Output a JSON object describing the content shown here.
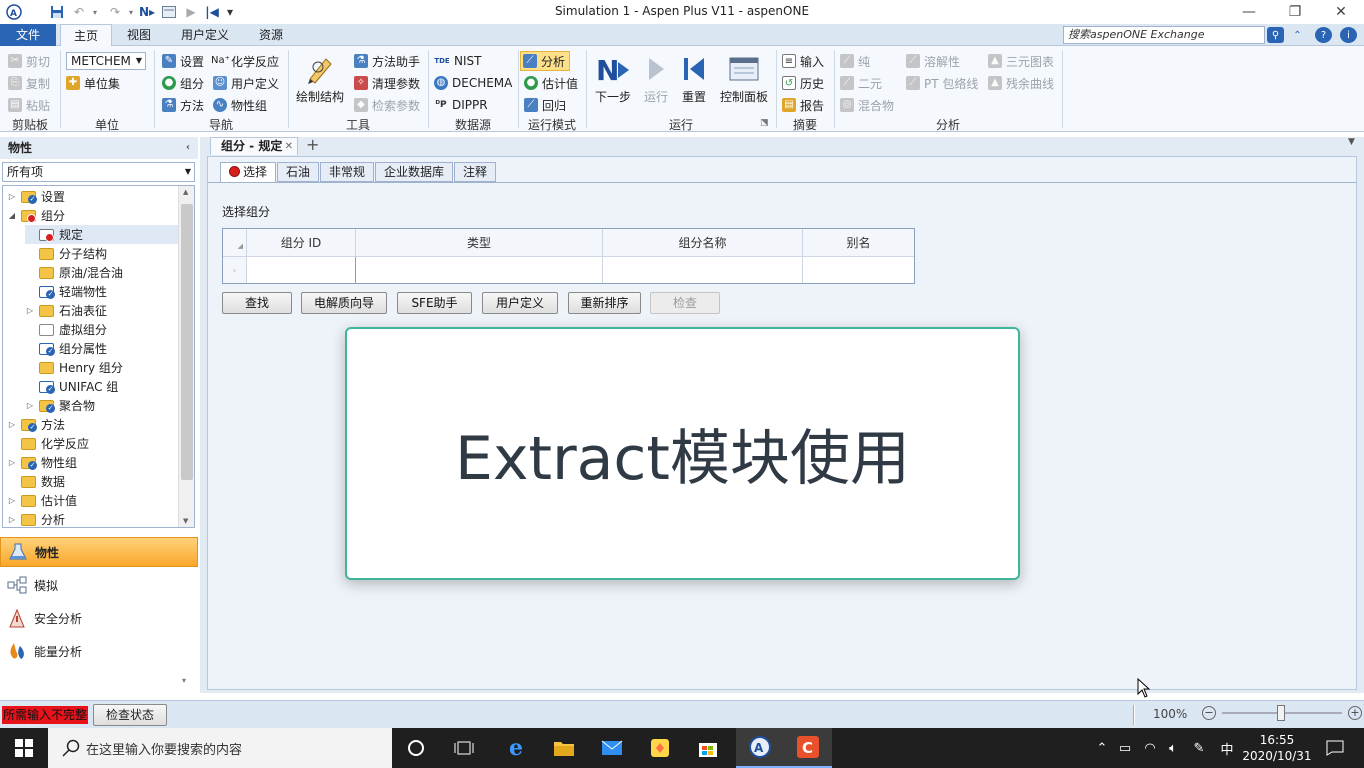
{
  "window": {
    "title": "Simulation 1 - Aspen Plus V11 - aspenONE"
  },
  "quick_access": {
    "save_icon": "save-icon",
    "undo_icon": "undo-icon",
    "redo_icon": "redo-icon",
    "next_icon": "next-icon",
    "run_icon": "run-icon",
    "reset_icon": "reset-icon",
    "menu_icon": "menu-icon"
  },
  "menu": {
    "tabs": [
      "文件",
      "主页",
      "视图",
      "用户定义",
      "资源"
    ],
    "active": "主页",
    "search_placeholder": "搜索aspenONE Exchange"
  },
  "ribbon": {
    "clipboard": {
      "cut": "剪切",
      "copy": "复制",
      "paste": "粘贴",
      "label": "剪贴板"
    },
    "units": {
      "unit_set": "METCHEM",
      "unit_sets": "单位集",
      "label": "单位"
    },
    "navigation": {
      "settings": "设置",
      "components": "组分",
      "methods": "方法",
      "chemistry": "化学反应",
      "user_defined": "用户定义",
      "prop_sets": "物性组",
      "label": "导航"
    },
    "tools": {
      "draw_structure": "绘制结构",
      "method_assistant": "方法助手",
      "clean_params": "清理参数",
      "retrieve_params": "检索参数",
      "label": "工具"
    },
    "data_source": {
      "nist": "NIST",
      "dechema": "DECHEMA",
      "dippr": "DIPPR",
      "label": "数据源"
    },
    "run_mode": {
      "analysis": "分析",
      "estimation": "估计值",
      "regression": "回归",
      "label": "运行模式"
    },
    "run": {
      "next": "下一步",
      "run": "运行",
      "reset": "重置",
      "control_panel": "控制面板",
      "label": "运行"
    },
    "summary": {
      "input": "输入",
      "history": "历史",
      "report": "报告",
      "label": "摘要"
    },
    "analysis": {
      "pure": "纯",
      "binary": "二元",
      "mixture": "混合物",
      "solubility": "溶解性",
      "pt_envelope": "PT 包络线",
      "ternary_maps": "三元图表",
      "residue_curves": "残余曲线",
      "label": "分析"
    }
  },
  "nav": {
    "header": "物性",
    "filter": "所有项",
    "tree": [
      {
        "label": "设置",
        "level": 0,
        "expander": "▷",
        "icon": "folder-check"
      },
      {
        "label": "组分",
        "level": 0,
        "expander": "◢",
        "icon": "folder-red"
      },
      {
        "label": "规定",
        "level": 1,
        "expander": "",
        "icon": "red-form",
        "selected": true
      },
      {
        "label": "分子结构",
        "level": 1,
        "expander": "",
        "icon": "folder"
      },
      {
        "label": "原油/混合油",
        "level": 1,
        "expander": "",
        "icon": "folder"
      },
      {
        "label": "轻端物性",
        "level": 1,
        "expander": "",
        "icon": "check-form"
      },
      {
        "label": "石油表征",
        "level": 1,
        "expander": "▷",
        "icon": "folder"
      },
      {
        "label": "虚拟组分",
        "level": 1,
        "expander": "",
        "icon": "empty-form"
      },
      {
        "label": "组分属性",
        "level": 1,
        "expander": "",
        "icon": "check-form"
      },
      {
        "label": "Henry 组分",
        "level": 1,
        "expander": "",
        "icon": "folder"
      },
      {
        "label": "UNIFAC 组",
        "level": 1,
        "expander": "",
        "icon": "check-form"
      },
      {
        "label": "聚合物",
        "level": 1,
        "expander": "▷",
        "icon": "folder-check"
      },
      {
        "label": "方法",
        "level": 0,
        "expander": "▷",
        "icon": "folder-check"
      },
      {
        "label": "化学反应",
        "level": 0,
        "expander": "",
        "icon": "folder"
      },
      {
        "label": "物性组",
        "level": 0,
        "expander": "▷",
        "icon": "folder-check"
      },
      {
        "label": "数据",
        "level": 0,
        "expander": "",
        "icon": "folder"
      },
      {
        "label": "估计值",
        "level": 0,
        "expander": "▷",
        "icon": "folder"
      },
      {
        "label": "分析",
        "level": 0,
        "expander": "▷",
        "icon": "folder"
      }
    ],
    "sections": [
      "物性",
      "模拟",
      "安全分析",
      "能量分析"
    ]
  },
  "doc": {
    "tab_label": "组分 - 规定",
    "form_tabs": [
      "选择",
      "石油",
      "非常规",
      "企业数据库",
      "注释"
    ],
    "section_title": "选择组分",
    "columns": [
      "组分 ID",
      "类型",
      "组分名称",
      "别名"
    ],
    "buttons": [
      "查找",
      "电解质向导",
      "SFE助手",
      "用户定义",
      "重新排序",
      "检查"
    ]
  },
  "overlay": {
    "text": "Extract模块使用"
  },
  "status": {
    "warning": "所需输入不完整",
    "check_status": "检查状态",
    "zoom": "100%"
  },
  "taskbar": {
    "search_placeholder": "在这里输入你要搜索的内容",
    "ime": "中",
    "time": "16:55",
    "date": "2020/10/31"
  },
  "colors": {
    "accent": "#2a64b5",
    "active_nav": "#f9a72b",
    "overlay_border": "#3fb59c",
    "warning": "#e8121a"
  }
}
